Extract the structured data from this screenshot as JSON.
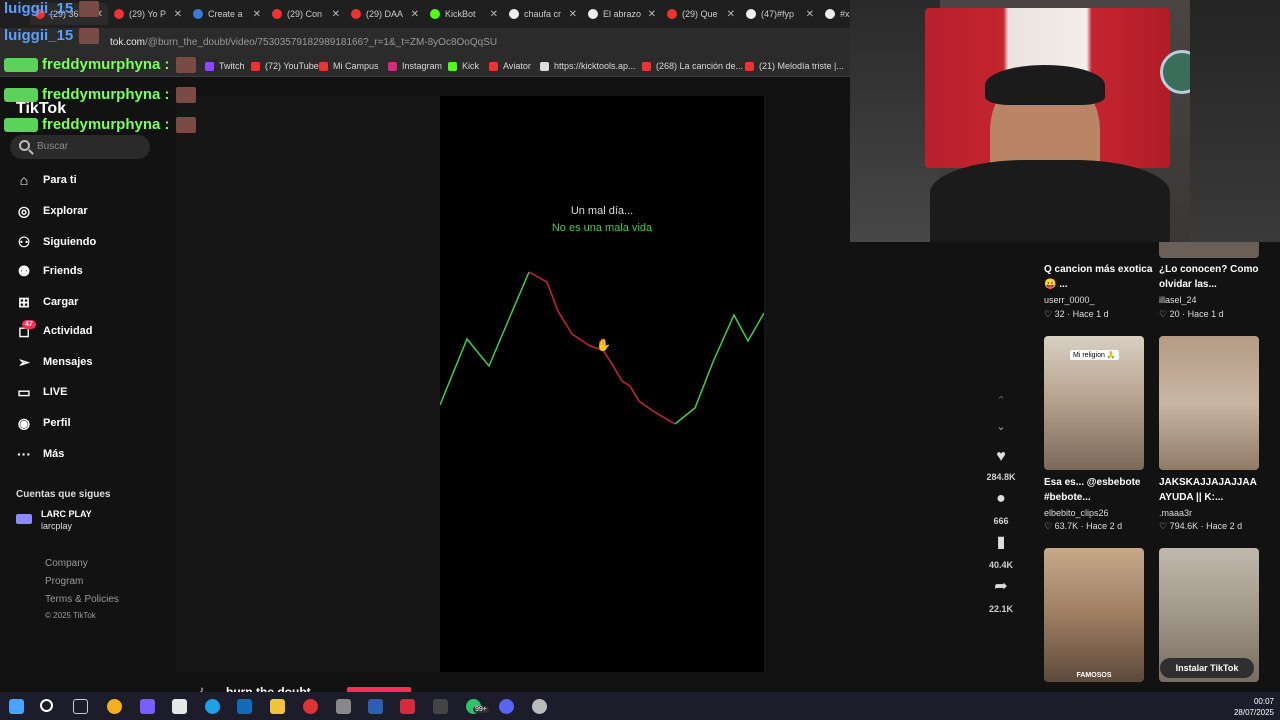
{
  "tabs": [
    {
      "label": "(29) 36",
      "color": "#e33"
    },
    {
      "label": "(29) Yo P",
      "color": "#e33"
    },
    {
      "label": "Create a",
      "color": "#3a7bd5"
    },
    {
      "label": "(29) Con",
      "color": "#e33"
    },
    {
      "label": "(29) DAA",
      "color": "#e33"
    },
    {
      "label": "KickBot",
      "color": "#53fc18"
    },
    {
      "label": "chaufa cr",
      "color": "#eee"
    },
    {
      "label": "El abrazo",
      "color": "#eee"
    },
    {
      "label": "(29) Que",
      "color": "#e33"
    },
    {
      "label": "(47)#fyp",
      "color": "#eee"
    },
    {
      "label": "#x",
      "color": "#eee"
    }
  ],
  "address": {
    "host": "tok.com",
    "path": "/@burn_the_doubt/video/7530357918298918166?_r=1&_t=ZM-8yOc8OoQqSU"
  },
  "bookmarks": [
    {
      "label": "Twitch",
      "color": "#9146ff"
    },
    {
      "label": "(72) YouTube",
      "color": "#e33"
    },
    {
      "label": "Mi Campus",
      "color": "#e33"
    },
    {
      "label": "Instagram",
      "color": "#d62976"
    },
    {
      "label": "Kick",
      "color": "#53fc18"
    },
    {
      "label": "Aviator",
      "color": "#e33"
    },
    {
      "label": "https://kicktools.ap...",
      "color": "#ddd"
    },
    {
      "label": "(268) La canción de...",
      "color": "#e33"
    },
    {
      "label": "(21) Melodía triste |...",
      "color": "#e33"
    }
  ],
  "logo": "TikTok",
  "search": {
    "placeholder": "Buscar"
  },
  "nav": [
    {
      "label": "Para ti",
      "icon": "home-icon"
    },
    {
      "label": "Explorar",
      "icon": "compass-icon"
    },
    {
      "label": "Siguiendo",
      "icon": "following-icon"
    },
    {
      "label": "Friends",
      "icon": "friends-icon"
    },
    {
      "label": "Cargar",
      "icon": "upload-icon"
    },
    {
      "label": "Actividad",
      "icon": "activity-icon"
    },
    {
      "label": "Mensajes",
      "icon": "messages-icon"
    },
    {
      "label": "LIVE",
      "icon": "live-icon"
    },
    {
      "label": "Perfil",
      "icon": "profile-icon"
    },
    {
      "label": "Más",
      "icon": "more-icon"
    }
  ],
  "activity_badge": "47",
  "following": {
    "title": "Cuentas que sigues",
    "accounts": [
      {
        "name": "LARC PLAY",
        "handle": "larcplay"
      }
    ]
  },
  "footer": [
    "Company",
    "Program",
    "Terms & Policies",
    "© 2025 TikTok"
  ],
  "video": {
    "line1": "Un mal día...",
    "line2": "No es una mala vida",
    "author": "burn the doubt",
    "colors": {
      "up": "#3ecf4a",
      "down": "#d0213a"
    }
  },
  "actions": {
    "likes": "284.8K",
    "comments": "666",
    "saves": "40.4K",
    "shares": "22.1K"
  },
  "grid": [
    {
      "title": "Q cancion más exotica😛 ...",
      "user": "userr_0000_",
      "likes": "32",
      "time": "Hace 1 d"
    },
    {
      "title": "¿Lo conocen? Como olvidar las...",
      "user": "illasel_24",
      "likes": "20",
      "time": "Hace 1 d"
    },
    {
      "title": "Esa es... @esbebote #bebote...",
      "user": "elbebito_clips26",
      "likes": "63.7K",
      "time": "Hace 2 d",
      "caption": "Mi religion 🙏"
    },
    {
      "title": "JAKSKAJJAJAJJAA AYUDA || K:...",
      "user": ".maaa3r",
      "likes": "794.6K",
      "time": "Hace 2 d"
    },
    {
      "caption": "FAMOSOS"
    },
    {}
  ],
  "install_button": "Instalar TikTok",
  "chat": [
    {
      "user": "luiggii_15",
      "color": "#5aa0ff"
    },
    {
      "user": "luiggii_15",
      "color": "#5aa0ff"
    },
    {
      "user": "freddymurphyna :",
      "color": "#7dff5a"
    },
    {
      "user": "freddymurphyna :",
      "color": "#7dff5a"
    },
    {
      "user": "freddymurphyna :",
      "color": "#7dff5a"
    }
  ],
  "clock": {
    "time": "00:07",
    "date": "28/07/2025"
  },
  "taskbar_badge": "99+"
}
